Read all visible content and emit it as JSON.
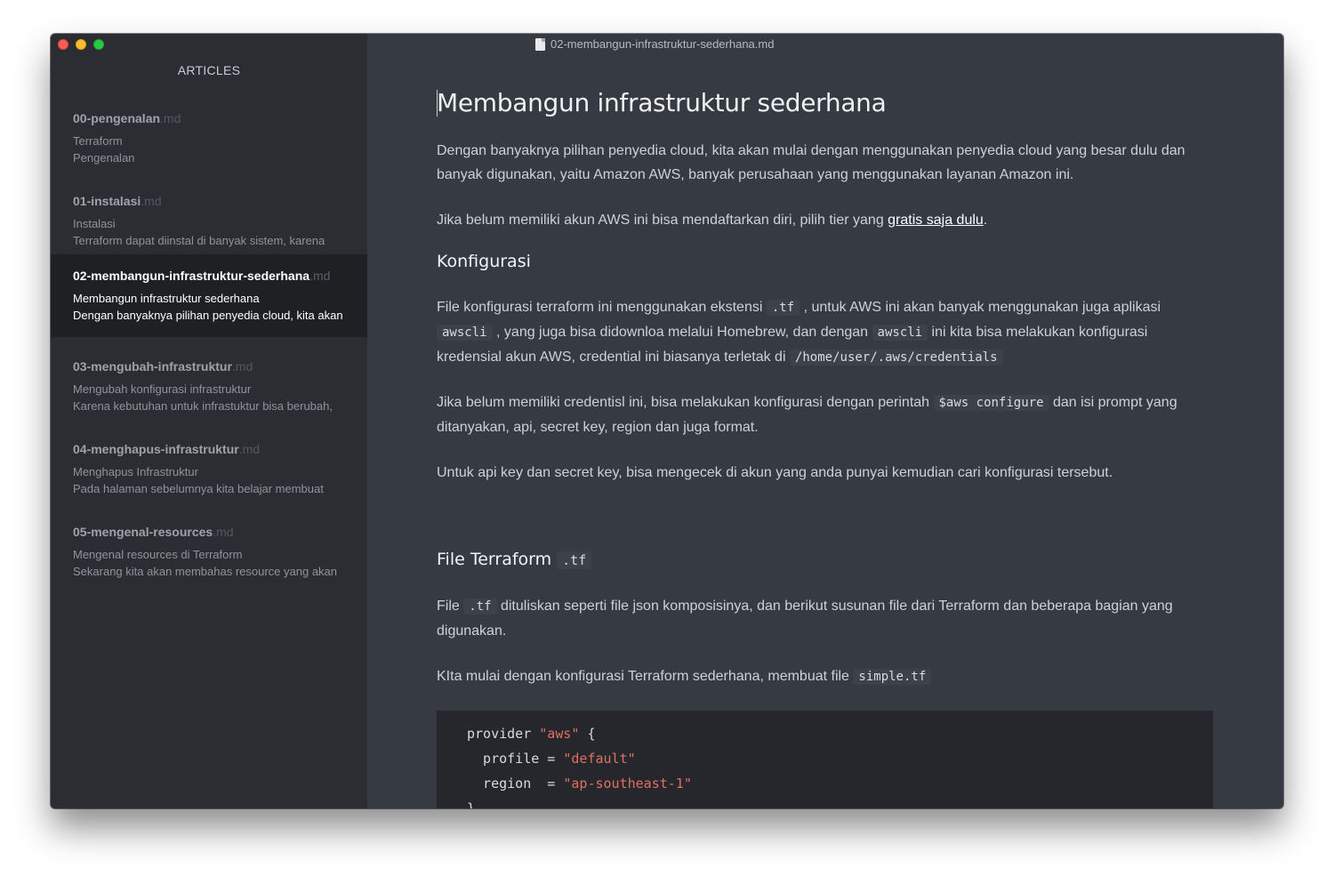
{
  "window": {
    "title": "02-membangun-infrastruktur-sederhana.md"
  },
  "sidebar": {
    "title": "ARTICLES",
    "items": [
      {
        "name": "00-pengenalan",
        "ext": ".md",
        "line1": "Terraform",
        "line2": "Pengenalan",
        "active": false
      },
      {
        "name": "01-instalasi",
        "ext": ".md",
        "line1": "Instalasi",
        "line2": "Terraform dapat diinstal di banyak sistem, karena",
        "active": false
      },
      {
        "name": "02-membangun-infrastruktur-sederhana",
        "ext": ".md",
        "line1": "Membangun infrastruktur sederhana",
        "line2": "Dengan banyaknya pilihan penyedia cloud, kita akan",
        "active": true
      },
      {
        "name": "03-mengubah-infrastruktur",
        "ext": ".md",
        "line1": "Mengubah konfigurasi infrastruktur",
        "line2": "Karena kebutuhan untuk infrastuktur bisa berubah,",
        "active": false
      },
      {
        "name": "04-menghapus-infrastruktur",
        "ext": ".md",
        "line1": "Menghapus Infrastruktur",
        "line2": "Pada halaman sebelumnya kita belajar membuat",
        "active": false
      },
      {
        "name": "05-mengenal-resources",
        "ext": ".md",
        "line1": "Mengenal resources di Terraform",
        "line2": "Sekarang kita akan membahas resource yang akan",
        "active": false
      }
    ]
  },
  "content": {
    "h1": "Membangun infrastruktur sederhana",
    "p1": "Dengan banyaknya pilihan penyedia cloud, kita akan mulai dengan menggunakan penyedia cloud yang besar dulu dan banyak digunakan, yaitu Amazon  AWS, banyak perusahaan yang menggunakan layanan Amazon ini.",
    "p2_before": "Jika belum memiliki akun AWS ini bisa mendaftarkan diri, pilih tier yang ",
    "p2_link": "gratis saja dulu",
    "p2_after": ".",
    "h2_konfigurasi": "Konfigurasi",
    "p3_a": "File konfigurasi terraform ini menggunakan ekstensi ",
    "p3_code1": ".tf",
    "p3_b": " , untuk AWS ini akan banyak menggunakan juga aplikasi ",
    "p3_code2": "awscli",
    "p3_c": " , yang juga bisa didownloa melalui Homebrew, dan dengan ",
    "p3_code3": "awscli",
    "p3_d": " ini kita bisa melakukan konfigurasi kredensial akun AWS, credential ini biasanya terletak di ",
    "p3_code4": "/home/user/.aws/credentials",
    "p4_a": "Jika belum memiliki credentisl ini, bisa melakukan konfigurasi dengan perintah ",
    "p4_code": "$aws configure",
    "p4_b": " dan isi prompt yang ditanyakan, api, secret key, region dan juga format.",
    "p5": "Untuk api key dan secret key, bisa mengecek di akun yang anda punyai kemudian cari konfigurasi tersebut.",
    "h2_file": "File Terraform",
    "h2_file_code": ".tf",
    "p6_a": "File ",
    "p6_code": ".tf",
    "p6_b": " dituliskan seperti file json komposisinya, dan berikut susunan file dari Terraform dan beberapa bagian yang digunakan.",
    "p7_a": "KIta mulai dengan konfigurasi Terraform sederhana, membuat file ",
    "p7_code": "simple.tf",
    "code": {
      "l1_a": "provider ",
      "l1_str": "\"aws\"",
      "l1_b": " {",
      "l2_a": "  profile = ",
      "l2_str": "\"default\"",
      "l3_a": "  region  = ",
      "l3_str": "\"ap-southeast-1\"",
      "l4": "}"
    }
  }
}
